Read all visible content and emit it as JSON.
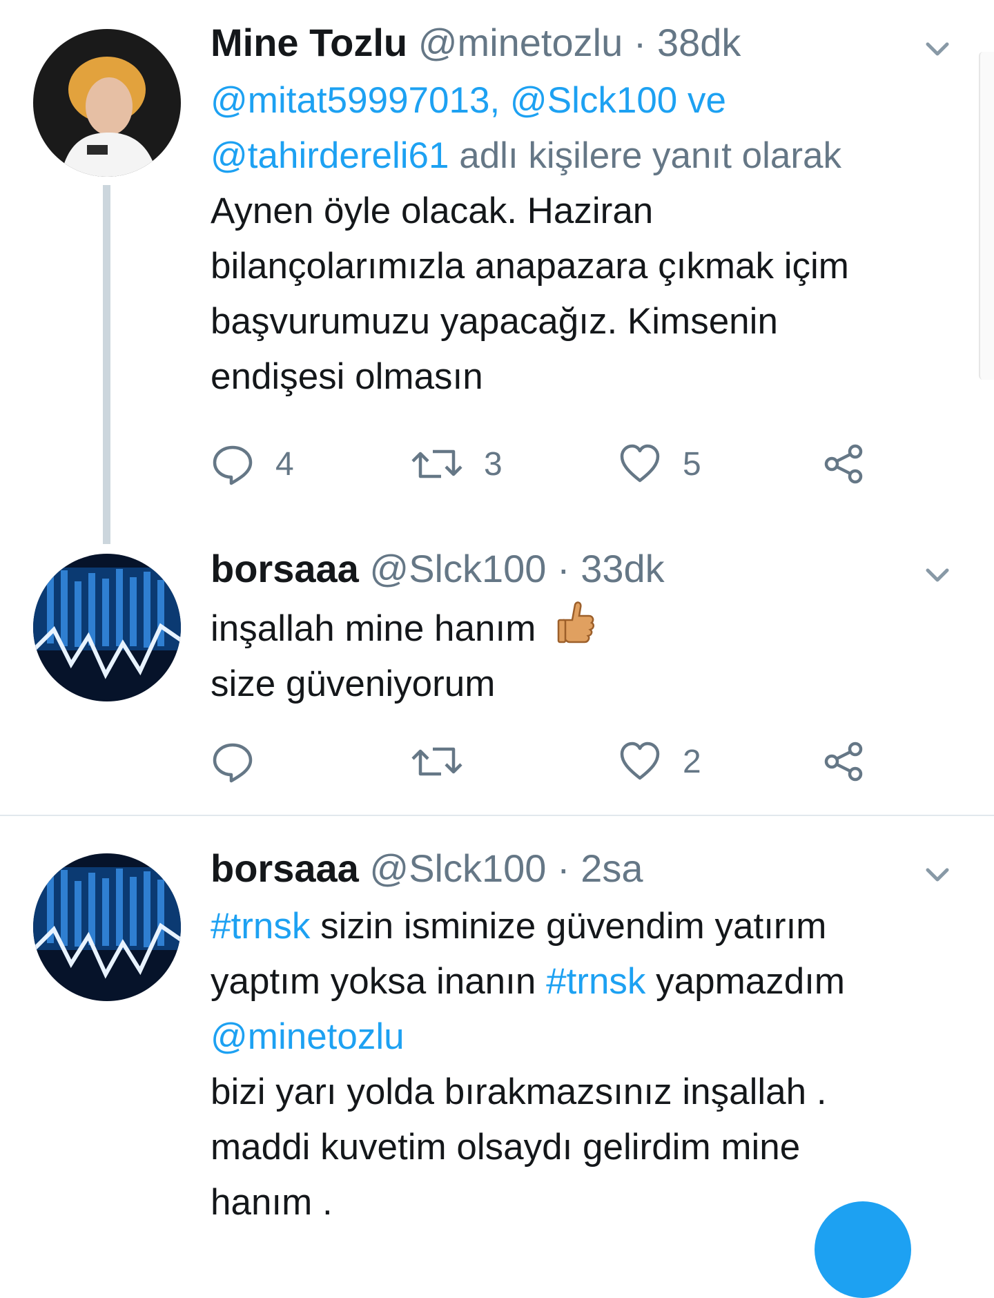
{
  "tweets": [
    {
      "name": "Mine Tozlu",
      "handle": "@minetozlu",
      "separator": "·",
      "time": "38dk",
      "reply_users": [
        "@mitat59997013,",
        "@Slck100",
        "ve",
        "@tahirdereli61"
      ],
      "reply_suffix": "adlı kişilere yanıt olarak",
      "lines": [
        "Aynen öyle olacak. Haziran",
        "bilançolarımızla anapazara çıkmak içim",
        "başvurumuzu yapacağız. Kimsenin",
        "endişesi olmasın"
      ],
      "reply_count": "4",
      "retweet_count": "3",
      "like_count": "5"
    },
    {
      "name": "borsaaa",
      "handle": "@Slck100",
      "separator": "·",
      "time": "33dk",
      "lines": [
        "inşallah mine hanım",
        "size güveniyorum"
      ],
      "emoji": "thumbs-up",
      "reply_count": "",
      "retweet_count": "",
      "like_count": "2"
    },
    {
      "name": "borsaaa",
      "handle": "@Slck100",
      "separator": "·",
      "time": "2sa",
      "hashtag": "#trnsk",
      "line1_rest": "sizin isminize güvendim yatırım",
      "line2_start": "yaptım yoksa inanın",
      "line2_end": "yapmazdım",
      "mention": "@minetozlu",
      "lines_after": [
        "bizi yarı yolda bırakmazsınız inşallah .",
        "maddi kuvetim olsaydı gelirdim mine",
        "hanım ."
      ]
    }
  ],
  "icons": {
    "reply": "reply-icon",
    "retweet": "retweet-icon",
    "like": "heart-icon",
    "share": "share-icon",
    "caret": "chevron-down-icon"
  },
  "colors": {
    "link": "#1da1f2",
    "secondary": "#657786",
    "icon": "#657786",
    "thread_line": "#ccd6dd"
  }
}
